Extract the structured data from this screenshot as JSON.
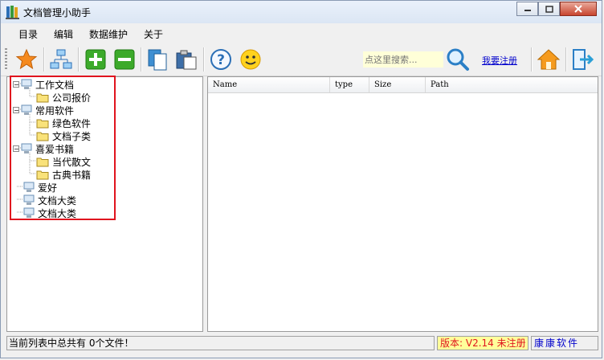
{
  "window": {
    "title": "文档管理小助手"
  },
  "menu": [
    {
      "label": "目录"
    },
    {
      "label": "编辑"
    },
    {
      "label": "数据维护"
    },
    {
      "label": "关于"
    }
  ],
  "toolbar": {
    "search_placeholder": "点这里搜索...",
    "register_label": "我要注册",
    "icons": [
      "star-icon",
      "network-icon",
      "add-icon",
      "remove-icon",
      "copy-icon",
      "paste-icon",
      "help-icon",
      "smiley-icon",
      "magnifier-icon",
      "home-icon",
      "exit-icon"
    ]
  },
  "tree": [
    {
      "label": "工作文档",
      "level": 0,
      "expander": "−"
    },
    {
      "label": "公司报价",
      "level": 1
    },
    {
      "label": "常用软件",
      "level": 0,
      "expander": "−"
    },
    {
      "label": "绿色软件",
      "level": 1
    },
    {
      "label": "文档子类",
      "level": 1
    },
    {
      "label": "喜爱书籍",
      "level": 0,
      "expander": "−"
    },
    {
      "label": "当代散文",
      "level": 1
    },
    {
      "label": "古典书籍",
      "level": 1
    },
    {
      "label": "爱好",
      "level": 0
    },
    {
      "label": "文档大类",
      "level": 0
    },
    {
      "label": "文档大类",
      "level": 0
    }
  ],
  "list": {
    "columns": [
      {
        "label": "Name"
      },
      {
        "label": "type"
      },
      {
        "label": "Size"
      },
      {
        "label": "Path"
      }
    ]
  },
  "status": {
    "summary": "当前列表中总共有 0个文件！",
    "version": "版本: V2.14 未注册",
    "brand": "康康软件"
  },
  "colors": {
    "highlight_box": "#e0141e",
    "version_bg": "#ffff9a",
    "link": "#0000cc"
  }
}
